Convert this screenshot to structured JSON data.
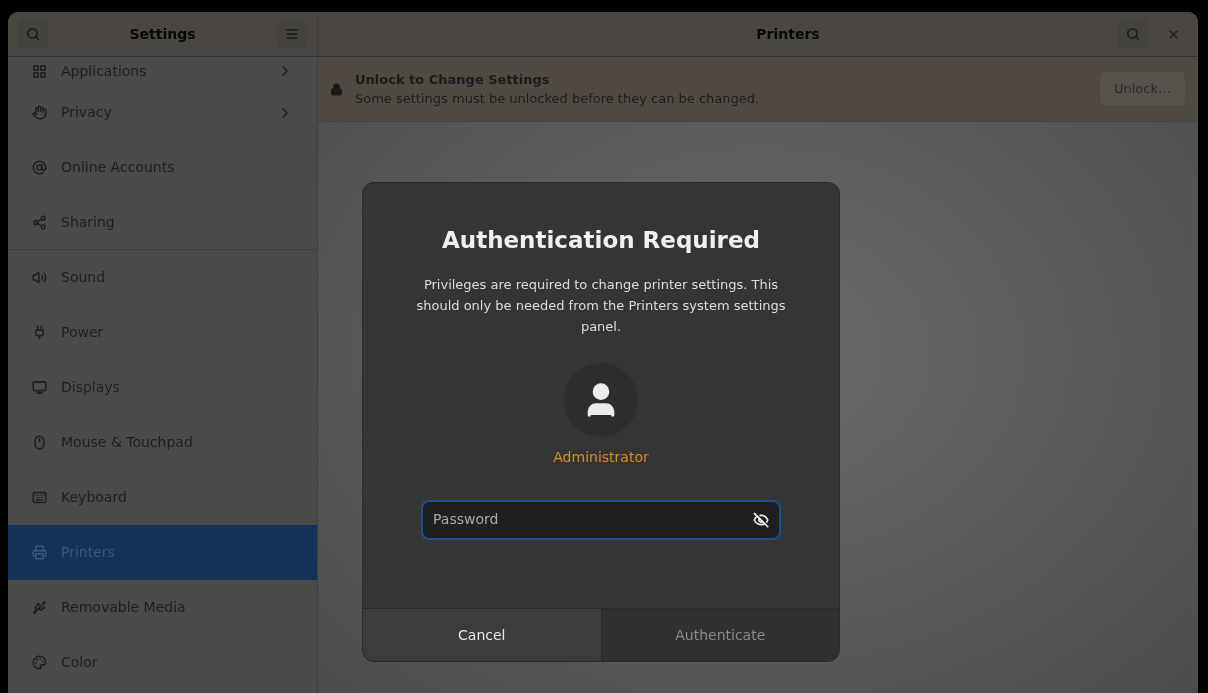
{
  "sidebar": {
    "title": "Settings",
    "items": [
      {
        "label": "Applications",
        "selected": false,
        "arrow": true,
        "separator_after": false
      },
      {
        "label": "Privacy",
        "selected": false,
        "arrow": true,
        "separator_after": false
      },
      {
        "label": "Online Accounts",
        "selected": false,
        "arrow": false,
        "separator_after": false
      },
      {
        "label": "Sharing",
        "selected": false,
        "arrow": false,
        "separator_after": true
      },
      {
        "label": "Sound",
        "selected": false,
        "arrow": false,
        "separator_after": false
      },
      {
        "label": "Power",
        "selected": false,
        "arrow": false,
        "separator_after": false
      },
      {
        "label": "Displays",
        "selected": false,
        "arrow": false,
        "separator_after": false
      },
      {
        "label": "Mouse & Touchpad",
        "selected": false,
        "arrow": false,
        "separator_after": false
      },
      {
        "label": "Keyboard",
        "selected": false,
        "arrow": false,
        "separator_after": false
      },
      {
        "label": "Printers",
        "selected": true,
        "arrow": false,
        "separator_after": false
      },
      {
        "label": "Removable Media",
        "selected": false,
        "arrow": false,
        "separator_after": false
      },
      {
        "label": "Color",
        "selected": false,
        "arrow": false,
        "separator_after": false
      }
    ]
  },
  "main": {
    "title": "Printers",
    "infobar": {
      "title": "Unlock to Change Settings",
      "message": "Some settings must be unlocked before they can be changed.",
      "button": "Unlock…"
    }
  },
  "dialog": {
    "title": "Authentication Required",
    "message": "Privileges are required to change printer settings. This should only be needed from the Printers system settings panel.",
    "user": "Administrator",
    "password": {
      "placeholder": "Password"
    },
    "buttons": [
      {
        "label": "Cancel",
        "disabled": false
      },
      {
        "label": "Authenticate",
        "disabled": true
      }
    ]
  }
}
